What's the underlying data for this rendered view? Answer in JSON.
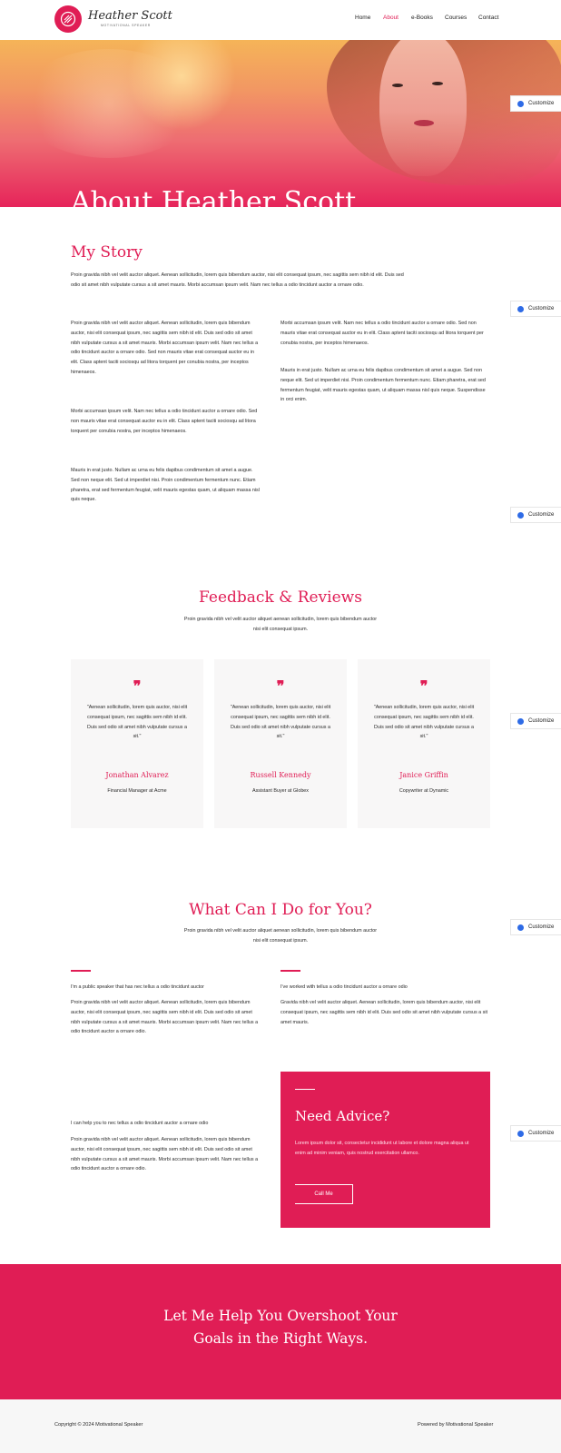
{
  "brand": {
    "name": "Heather Scott",
    "tagline": "MOTIVATIONAL SPEAKER",
    "accent": "#e01d55"
  },
  "nav": {
    "items": [
      "Home",
      "About",
      "e-Books",
      "Courses",
      "Contact"
    ],
    "active": "About"
  },
  "hero": {
    "title": "About Heather Scott"
  },
  "customize_label": "Customize",
  "story": {
    "title": "My Story",
    "intro": "Proin gravida nibh vel velit auctor aliquet. Aenean sollicitudin, lorem quis bibendum auctor, nisi elit consequat ipsum, nec sagittis sem nibh id elit. Duis sed odio sit amet nibh vulputate cursus a sit amet mauris. Morbi accumsan ipsum velit. Nam nec tellus a odio tincidunt auctor a ornare odio.",
    "left_paragraphs": [
      "Proin gravida nibh vel velit auctor aliquet. Aenean sollicitudin, lorem quis bibendum auctor, nisi elit consequat ipsum, nec sagittis sem nibh id elit. Duis sed odio sit amet nibh vulputate cursus a sit amet mauris. Morbi accumsan ipsum velit. Nam nec tellus a odio tincidunt auctor a ornare odio. Sed non mauris vitae erat consequat auctor eu in elit. Class aptent taciti sociosqu ad litora torquent per conubia nostra, per inceptos himenaeos.",
      "Morbi accumsan ipsum velit. Nam nec tellus a odio tincidunt auctor a ornare odio. Sed non mauris vitae erat consequat auctor eu in elit. Class aptent taciti sociosqu ad litora torquent per conubia nostra, per inceptos himenaeos.",
      "Mauris in erat justo. Nullam ac urna eu felis dapibus condimentum sit amet a augue. Sed non neque elit. Sed ut imperdiet nisi. Proin condimentum fermentum nunc. Etiam pharetra, erat sed fermentum feugiat, velit mauris egestas quam, ut aliquam massa nisl quis neque."
    ],
    "right_paragraphs": [
      "Morbi accumsan ipsum velit. Nam nec tellus a odio tincidunt auctor a ornare odio. Sed non mauris vitae erat consequat auctor eu in elit. Class aptent taciti sociosqu ad litora torquent per conubia nostra, per inceptos himenaeos.",
      "Mauris in erat justo. Nullam ac urna eu felis dapibus condimentum sit amet a augue. Sed non neque elit. Sed ut imperdiet nisi. Proin condimentum fermentum nunc. Etiam pharetra, erat sed fermentum feugiat, velit mauris egestas quam, ut aliquam massa nisl quis neque. Suspendisse in orci enim."
    ]
  },
  "reviews": {
    "title": "Feedback & Reviews",
    "subtitle": "Proin gravida nibh vel velit auctor aliquet aenean sollicitudin, lorem quis bibendum auctor nisi elit consequat ipsum.",
    "items": [
      {
        "quote": "\"Aenean sollicitudin, lorem quis auctor, nisi elit consequat ipsum, nec sagittis sem nibh id elit. Duis sed odio sit amet nibh vulputate cursus a sit.\"",
        "name": "Jonathan Alvarez",
        "role": "Financial Manager at Acme"
      },
      {
        "quote": "\"Aenean sollicitudin, lorem quis auctor, nisi elit consequat ipsum, nec sagittis sem nibh id elit. Duis sed odio sit amet nibh vulputate cursus a sit.\"",
        "name": "Russell Kennedy",
        "role": "Assistant Buyer at Globex"
      },
      {
        "quote": "\"Aenean sollicitudin, lorem quis auctor, nisi elit consequat ipsum, nec sagittis sem nibh id elit. Duis sed odio sit amet nibh vulputate cursus a sit.\"",
        "name": "Janice Griffin",
        "role": "Copywriter at Dynamic"
      }
    ]
  },
  "services": {
    "title": "What Can I Do for You?",
    "subtitle": "Proin gravida nibh vel velit auctor aliquet aenean sollicitudin, lorem quis bibendum auctor nisi elit consequat ipsum.",
    "block1": {
      "heading": "I'm a public speaker that has nec tellus a odio tincidunt auctor",
      "text": "Proin gravida nibh vel velit auctor aliquet. Aenean sollicitudin, lorem quis bibendum auctor, nisi elit consequat ipsum, nec sagittis sem nibh id elit. Duis sed odio sit amet nibh vulputate cursus a sit amet mauris. Morbi accumsan ipsum velit. Nam nec tellus a odio tincidunt auctor a ornare odio."
    },
    "block2": {
      "heading": "I've worked with tellus a odio tincidunt auctor a ornare odio",
      "text": "Gravida nibh vel velit auctor aliquet. Aenean sollicitudin, lorem quis bibendum auctor, nisi elit consequat ipsum, nec sagittis sem nibh id elit. Duis sed odio sit amet nibh vulputate cursus a sit amet mauris."
    },
    "block3": {
      "heading": "I can help you to nec tellus a odio tincidunt auctor a ornare odio",
      "text": "Proin gravida nibh vel velit auctor aliquet. Aenean sollicitudin, lorem quis bibendum auctor, nisi elit consequat ipsum, nec sagittis sem nibh id elit. Duis sed odio sit amet nibh vulputate cursus a sit amet mauris. Morbi accumsan ipsum velit. Nam nec tellus a odio tincidunt auctor a ornare odio."
    }
  },
  "advice": {
    "title": "Need Advice?",
    "text": "Lorem ipsum dolor sit, consectetur incididunt ut labore et dolore magna aliqua ut enim ad minim veniam, quis nostrud exercitation ullamco.",
    "button": "Call Me"
  },
  "cta": {
    "line1": "Let Me Help You Overshoot Your",
    "line2": "Goals in the Right Ways."
  },
  "footer": {
    "copyright": "Copyright © 2024 Motivational Speaker",
    "powered": "Powered by Motivational Speaker"
  }
}
